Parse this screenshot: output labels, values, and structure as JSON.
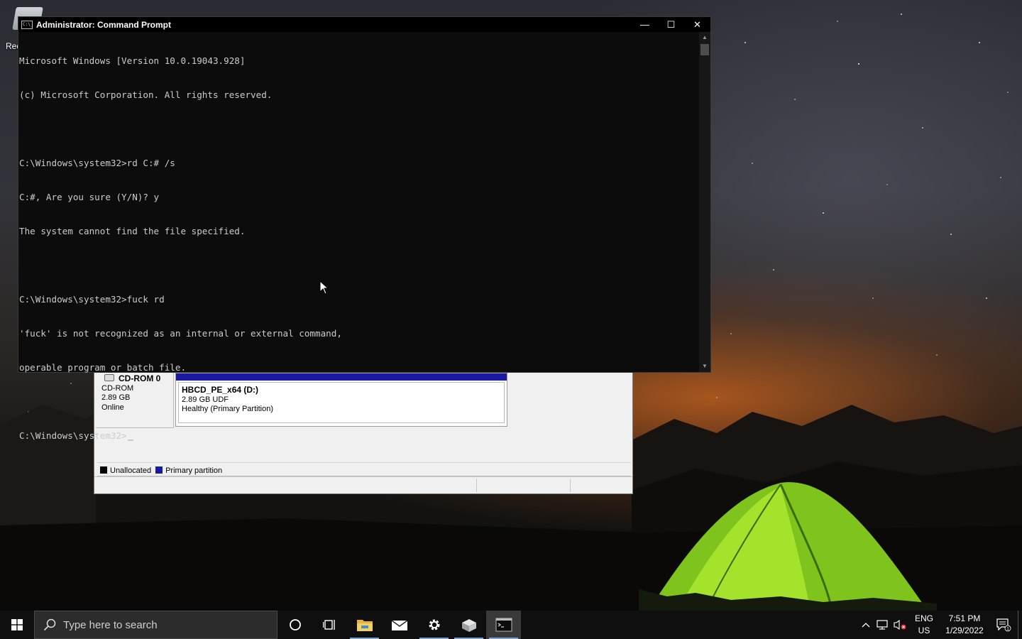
{
  "desktop": {
    "icon_label": "Rec"
  },
  "disk_management": {
    "disk": {
      "name": "CD-ROM 0",
      "type": "CD-ROM",
      "size": "2.89 GB",
      "status": "Online"
    },
    "partition": {
      "name": "HBCD_PE_x64  (D:)",
      "size_fs": "2.89 GB UDF",
      "status": "Healthy (Primary Partition)"
    },
    "legend": [
      {
        "label": "Unallocated",
        "color": "#000000"
      },
      {
        "label": "Primary partition",
        "color": "#1a1aa0"
      }
    ]
  },
  "cmd": {
    "title": "Administrator: Command Prompt",
    "lines": [
      "Microsoft Windows [Version 10.0.19043.928]",
      "(c) Microsoft Corporation. All rights reserved.",
      "",
      "C:\\Windows\\system32>rd C:# /s",
      "C:#, Are you sure (Y/N)? y",
      "The system cannot find the file specified.",
      "",
      "C:\\Windows\\system32>fuck rd",
      "'fuck' is not recognized as an internal or external command,",
      "operable program or batch file.",
      "",
      "C:\\Windows\\system32>"
    ],
    "buttons": {
      "minimize": "—",
      "maximize": "☐",
      "close": "✕"
    }
  },
  "taskbar": {
    "search_placeholder": "Type here to search",
    "lang_top": "ENG",
    "lang_bottom": "US",
    "time": "7:51 PM",
    "date": "1/29/2022",
    "notification_count": "1",
    "pinned": [
      "cortana-icon",
      "task-view-icon",
      "file-explorer-icon",
      "mail-icon",
      "settings-icon",
      "disk-management-icon",
      "command-prompt-icon"
    ]
  },
  "colors": {
    "accent": "#7aa6d6",
    "console_bg": "#0c0c0c",
    "console_fg": "#cccccc"
  }
}
